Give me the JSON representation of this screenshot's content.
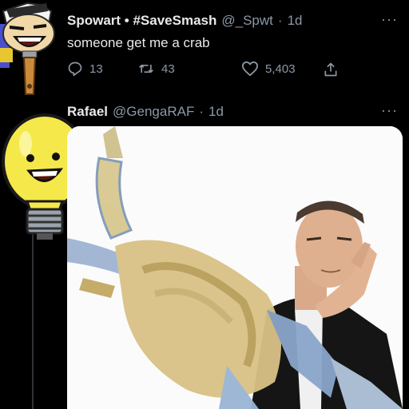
{
  "tweets": [
    {
      "display_name": "Spowart • #SaveSmash",
      "handle": "@_Spwt",
      "separator": "·",
      "time": "1d",
      "text": "someone get me a crab",
      "reply_count": "13",
      "retweet_count": "43",
      "like_count": "5,403",
      "avatar_icon": "paintbrush-character-avatar"
    },
    {
      "display_name": "Rafael",
      "handle": "@GengaRAF",
      "separator": "·",
      "time": "1d",
      "avatar_icon": "lightbulb-character-avatar",
      "media": "photo-crab-and-man"
    }
  ],
  "more_label": "···",
  "icons": [
    "reply-icon",
    "retweet-icon",
    "like-icon",
    "share-icon"
  ],
  "colors": {
    "background": "#000000",
    "text": "#e7e9ea",
    "secondary": "#8b98a5"
  }
}
